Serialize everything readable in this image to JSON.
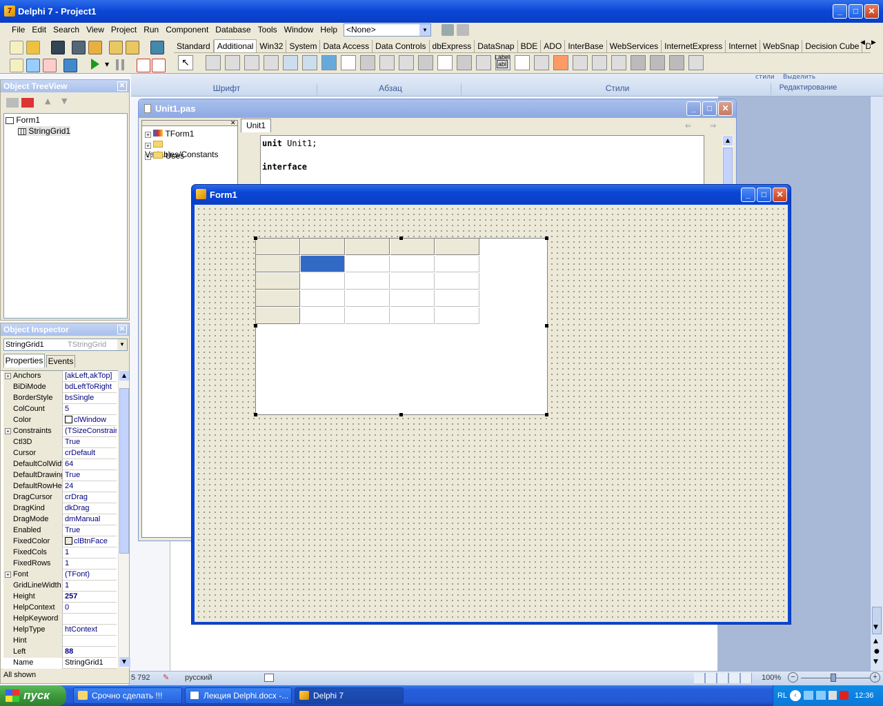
{
  "main_window": {
    "title": "Delphi 7 - Project1"
  },
  "menu": [
    "File",
    "Edit",
    "Search",
    "View",
    "Project",
    "Run",
    "Component",
    "Database",
    "Tools",
    "Window",
    "Help"
  ],
  "toolbar": {
    "desktop_combo_value": "<None>",
    "palette_tabs": [
      "Standard",
      "Additional",
      "Win32",
      "System",
      "Data Access",
      "Data Controls",
      "dbExpress",
      "DataSnap",
      "BDE",
      "ADO",
      "InterBase",
      "WebServices",
      "InternetExpress",
      "Internet",
      "WebSnap",
      "Decision Cube",
      "Dialo"
    ],
    "active_tab": "Additional",
    "label_component_text": "Label",
    "label_component_sub": "abl"
  },
  "word_ribbon": {
    "groups": [
      "Шрифт",
      "Абзац",
      "Стили",
      "Редактирование"
    ],
    "styles_button": "стили",
    "select_button": "Выделить"
  },
  "tree_view": {
    "title": "Object TreeView",
    "items": [
      "Form1",
      "StringGrid1"
    ]
  },
  "inspector": {
    "title": "Object Inspector",
    "object_name": "StringGrid1",
    "object_type": "TStringGrid",
    "tabs": [
      "Properties",
      "Events"
    ],
    "properties": [
      {
        "name": "Anchors",
        "value": "[akLeft,akTop]",
        "expand": true
      },
      {
        "name": "BiDiMode",
        "value": "bdLeftToRight"
      },
      {
        "name": "BorderStyle",
        "value": "bsSingle"
      },
      {
        "name": "ColCount",
        "value": "5"
      },
      {
        "name": "Color",
        "value": "clWindow",
        "swatch": "#ffffff"
      },
      {
        "name": "Constraints",
        "value": "(TSizeConstraints)",
        "expand": true
      },
      {
        "name": "Ctl3D",
        "value": "True"
      },
      {
        "name": "Cursor",
        "value": "crDefault"
      },
      {
        "name": "DefaultColWidth",
        "value": "64"
      },
      {
        "name": "DefaultDrawing",
        "value": "True"
      },
      {
        "name": "DefaultRowHeight",
        "value": "24"
      },
      {
        "name": "DragCursor",
        "value": "crDrag"
      },
      {
        "name": "DragKind",
        "value": "dkDrag"
      },
      {
        "name": "DragMode",
        "value": "dmManual"
      },
      {
        "name": "Enabled",
        "value": "True"
      },
      {
        "name": "FixedColor",
        "value": "clBtnFace",
        "swatch": "#ece9d8"
      },
      {
        "name": "FixedCols",
        "value": "1"
      },
      {
        "name": "FixedRows",
        "value": "1"
      },
      {
        "name": "Font",
        "value": "(TFont)",
        "expand": true
      },
      {
        "name": "GridLineWidth",
        "value": "1"
      },
      {
        "name": "Height",
        "value": "257",
        "bold": true
      },
      {
        "name": "HelpContext",
        "value": "0"
      },
      {
        "name": "HelpKeyword",
        "value": ""
      },
      {
        "name": "HelpType",
        "value": "htContext"
      },
      {
        "name": "Hint",
        "value": ""
      },
      {
        "name": "Left",
        "value": "88",
        "bold": true
      },
      {
        "name": "Name",
        "value": "StringGrid1"
      }
    ],
    "status": "All shown"
  },
  "code_editor": {
    "title": "Unit1.pas",
    "tab": "Unit1",
    "explorer_items": [
      "TForm1",
      "Variables/Constants",
      "Uses"
    ],
    "code_lines": [
      {
        "kw": "unit",
        "rest": " Unit1;"
      },
      {
        "kw": "",
        "rest": ""
      },
      {
        "kw": "interface",
        "rest": ""
      }
    ]
  },
  "form": {
    "title": "Form1"
  },
  "word_status": {
    "word_count": "5 792",
    "language": "русский",
    "zoom": "100%"
  },
  "taskbar": {
    "start_label": "пуск",
    "buttons": [
      "Срочно сделать !!!",
      "Лекция Delphi.docx -...",
      "Delphi 7"
    ],
    "active_index": 2,
    "lang": "RL",
    "clock": "12:36"
  }
}
